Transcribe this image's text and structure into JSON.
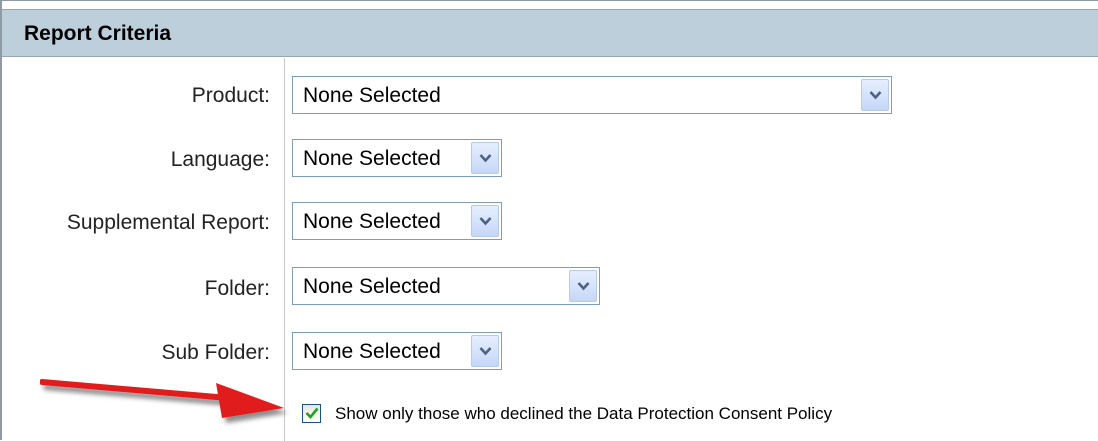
{
  "panel": {
    "title": "Report Criteria"
  },
  "fields": [
    {
      "label": "Product:",
      "value": "None Selected"
    },
    {
      "label": "Language:",
      "value": "None Selected"
    },
    {
      "label": "Supplemental Report:",
      "value": "None Selected"
    },
    {
      "label": "Folder:",
      "value": "None Selected"
    },
    {
      "label": "Sub Folder:",
      "value": "None Selected"
    }
  ],
  "checkbox": {
    "label": "Show only those who declined the Data Protection Consent Policy",
    "checked": true
  },
  "colors": {
    "header": "#bdcfda",
    "arrow": "#e01e1e",
    "checkmark": "#21a121"
  },
  "icons": {
    "dropdown": "chevron-down-icon",
    "annotation": "red-arrow-icon",
    "check": "checkmark-icon"
  }
}
